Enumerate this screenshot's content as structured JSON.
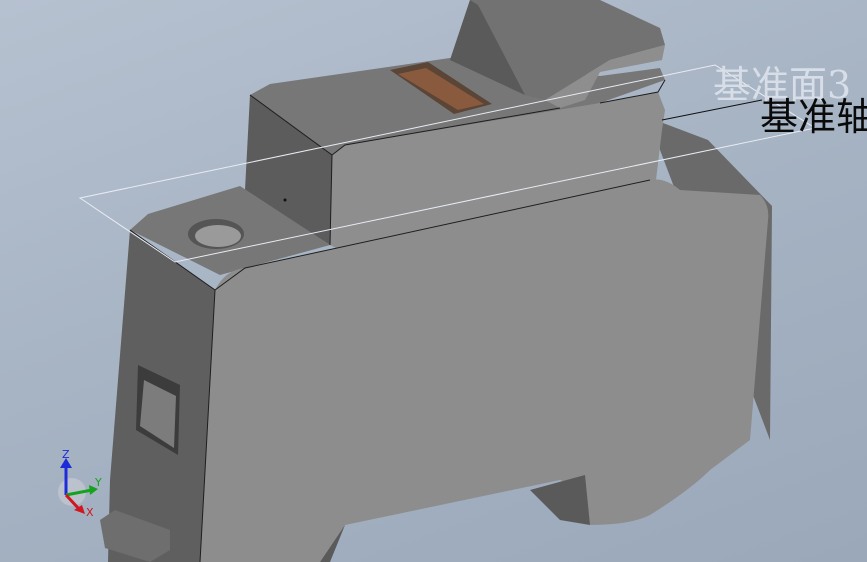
{
  "viewport": {
    "datum_plane_label": "基准面3",
    "datum_axis_label": "基准轴"
  },
  "triad": {
    "z_label": "Z",
    "y_label": "Y",
    "x_label": "X"
  },
  "colors": {
    "background": "#a7b4c4",
    "body_front": "#8d8d8d",
    "body_side": "#5f5f5f",
    "body_top": "#737373",
    "slot_brown": "#8a5a3e",
    "axis_x": "#d0161e",
    "axis_y": "#15a31e",
    "axis_z": "#1d2bd8"
  }
}
